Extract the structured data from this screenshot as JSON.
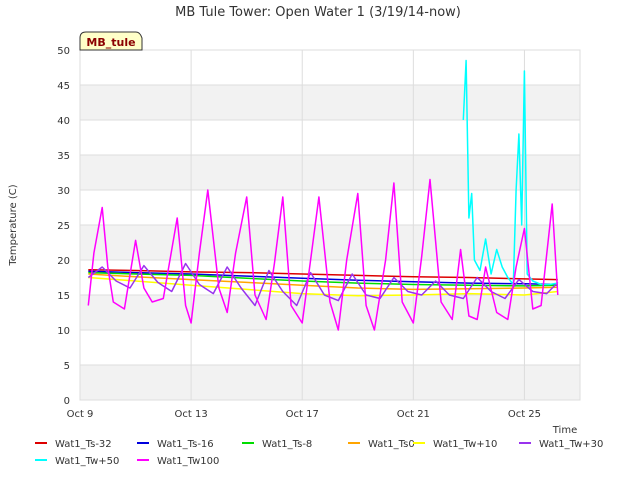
{
  "chart_data": {
    "type": "line",
    "title": "MB Tule Tower: Open Water 1 (3/19/14-now)",
    "site_label": "MB_tule",
    "xlabel": "Time",
    "ylabel": "Temperature (C)",
    "ylim": [
      0,
      50
    ],
    "yticks": [
      0,
      5,
      10,
      15,
      20,
      25,
      30,
      35,
      40,
      45,
      50
    ],
    "xlim": [
      9,
      27
    ],
    "xticks": [
      {
        "value": 9,
        "label": "Oct 9"
      },
      {
        "value": 13,
        "label": "Oct 13"
      },
      {
        "value": 17,
        "label": "Oct 17"
      },
      {
        "value": 21,
        "label": "Oct 21"
      },
      {
        "value": 25,
        "label": "Oct 25"
      }
    ],
    "grid": true,
    "legend_position": "bottom",
    "series": [
      {
        "name": "Wat1_Ts-32",
        "color": "#dd0000",
        "x": [
          9.3,
          11,
          13,
          15,
          17,
          19,
          21,
          23,
          25,
          26.2
        ],
        "y": [
          18.6,
          18.5,
          18.3,
          18.2,
          18.0,
          17.8,
          17.6,
          17.5,
          17.3,
          17.2
        ]
      },
      {
        "name": "Wat1_Ts-16",
        "color": "#0000dd",
        "x": [
          9.3,
          11,
          13,
          15,
          17,
          19,
          21,
          23,
          25,
          26.2
        ],
        "y": [
          18.4,
          18.2,
          18.0,
          17.7,
          17.4,
          17.1,
          16.9,
          16.7,
          16.6,
          16.5
        ]
      },
      {
        "name": "Wat1_Ts-8",
        "color": "#00dd00",
        "x": [
          9.3,
          11,
          13,
          15,
          17,
          19,
          21,
          23,
          25,
          26.2
        ],
        "y": [
          18.2,
          18.0,
          17.8,
          17.4,
          17.0,
          16.7,
          16.5,
          16.4,
          16.3,
          16.4
        ]
      },
      {
        "name": "Wat1_Ts0",
        "color": "#ffa500",
        "x": [
          9.3,
          11,
          13,
          15,
          17,
          19,
          21,
          23,
          25,
          26.2
        ],
        "y": [
          18.0,
          17.6,
          17.2,
          16.8,
          16.4,
          16.0,
          15.8,
          15.9,
          16.0,
          16.1
        ]
      },
      {
        "name": "Wat1_Tw+10",
        "color": "#ffff00",
        "x": [
          9.3,
          11,
          13,
          15,
          17,
          19,
          21,
          23,
          25,
          26.2
        ],
        "y": [
          17.5,
          17.0,
          16.4,
          15.8,
          15.2,
          14.9,
          15.0,
          15.2,
          15.0,
          15.5
        ]
      },
      {
        "name": "Wat1_Tw+30",
        "color": "#9933ee",
        "x": [
          9.3,
          9.8,
          10.3,
          10.8,
          11.3,
          11.8,
          12.3,
          12.8,
          13.3,
          13.8,
          14.3,
          14.8,
          15.3,
          15.8,
          16.3,
          16.8,
          17.3,
          17.8,
          18.3,
          18.8,
          19.3,
          19.8,
          20.3,
          20.8,
          21.3,
          21.8,
          22.3,
          22.8,
          23.3,
          23.8,
          24.3,
          24.8,
          25.3,
          25.8,
          26.2
        ],
        "y": [
          17.5,
          19.0,
          17.0,
          16.0,
          19.2,
          16.8,
          15.5,
          19.5,
          16.5,
          15.2,
          19.0,
          16.0,
          13.5,
          18.5,
          15.5,
          13.5,
          18.2,
          15.0,
          14.2,
          18.0,
          15.0,
          14.5,
          17.5,
          15.5,
          15.0,
          17.0,
          15.0,
          14.5,
          17.5,
          15.5,
          14.5,
          17.2,
          15.5,
          15.2,
          16.8
        ]
      },
      {
        "name": "Wat1_Tw+50",
        "color": "#00ffff",
        "x": [
          22.8,
          22.9,
          23.0,
          23.1,
          23.2,
          23.4,
          23.6,
          23.8,
          24.0,
          24.2,
          24.4,
          24.6,
          24.7,
          24.8,
          24.9,
          25.0,
          25.1,
          25.3,
          25.6,
          25.9,
          26.2
        ],
        "y": [
          40.0,
          48.5,
          26.0,
          29.5,
          20.0,
          18.5,
          23.0,
          18.0,
          21.5,
          19.0,
          17.5,
          16.5,
          30.0,
          38.0,
          25.0,
          47.0,
          18.0,
          17.0,
          16.5,
          16.5,
          16.7
        ]
      },
      {
        "name": "Wat1_Tw100",
        "color": "#ff00ff",
        "x": [
          9.3,
          9.5,
          9.8,
          10.0,
          10.2,
          10.6,
          11.0,
          11.3,
          11.6,
          12.0,
          12.5,
          12.8,
          13.0,
          13.3,
          13.6,
          14.0,
          14.3,
          14.6,
          15.0,
          15.3,
          15.7,
          16.0,
          16.3,
          16.6,
          17.0,
          17.3,
          17.6,
          18.0,
          18.3,
          18.6,
          19.0,
          19.3,
          19.6,
          20.0,
          20.3,
          20.6,
          21.0,
          21.3,
          21.6,
          22.0,
          22.4,
          22.7,
          23.0,
          23.3,
          23.6,
          24.0,
          24.4,
          24.7,
          25.0,
          25.3,
          25.6,
          26.0,
          26.2
        ],
        "y": [
          13.5,
          21.0,
          27.5,
          19.0,
          14.0,
          13.0,
          22.8,
          16.0,
          14.0,
          14.5,
          26.0,
          13.5,
          11.0,
          21.0,
          30.0,
          16.0,
          12.5,
          21.0,
          29.0,
          15.0,
          11.5,
          19.5,
          29.0,
          13.5,
          11.0,
          20.0,
          29.0,
          14.0,
          10.0,
          20.0,
          29.5,
          13.5,
          10.0,
          20.0,
          31.0,
          14.0,
          11.0,
          20.5,
          31.5,
          14.0,
          11.5,
          21.5,
          12.0,
          11.5,
          19.0,
          12.5,
          11.5,
          19.0,
          24.5,
          13.0,
          13.5,
          28.0,
          15.0
        ]
      }
    ]
  }
}
